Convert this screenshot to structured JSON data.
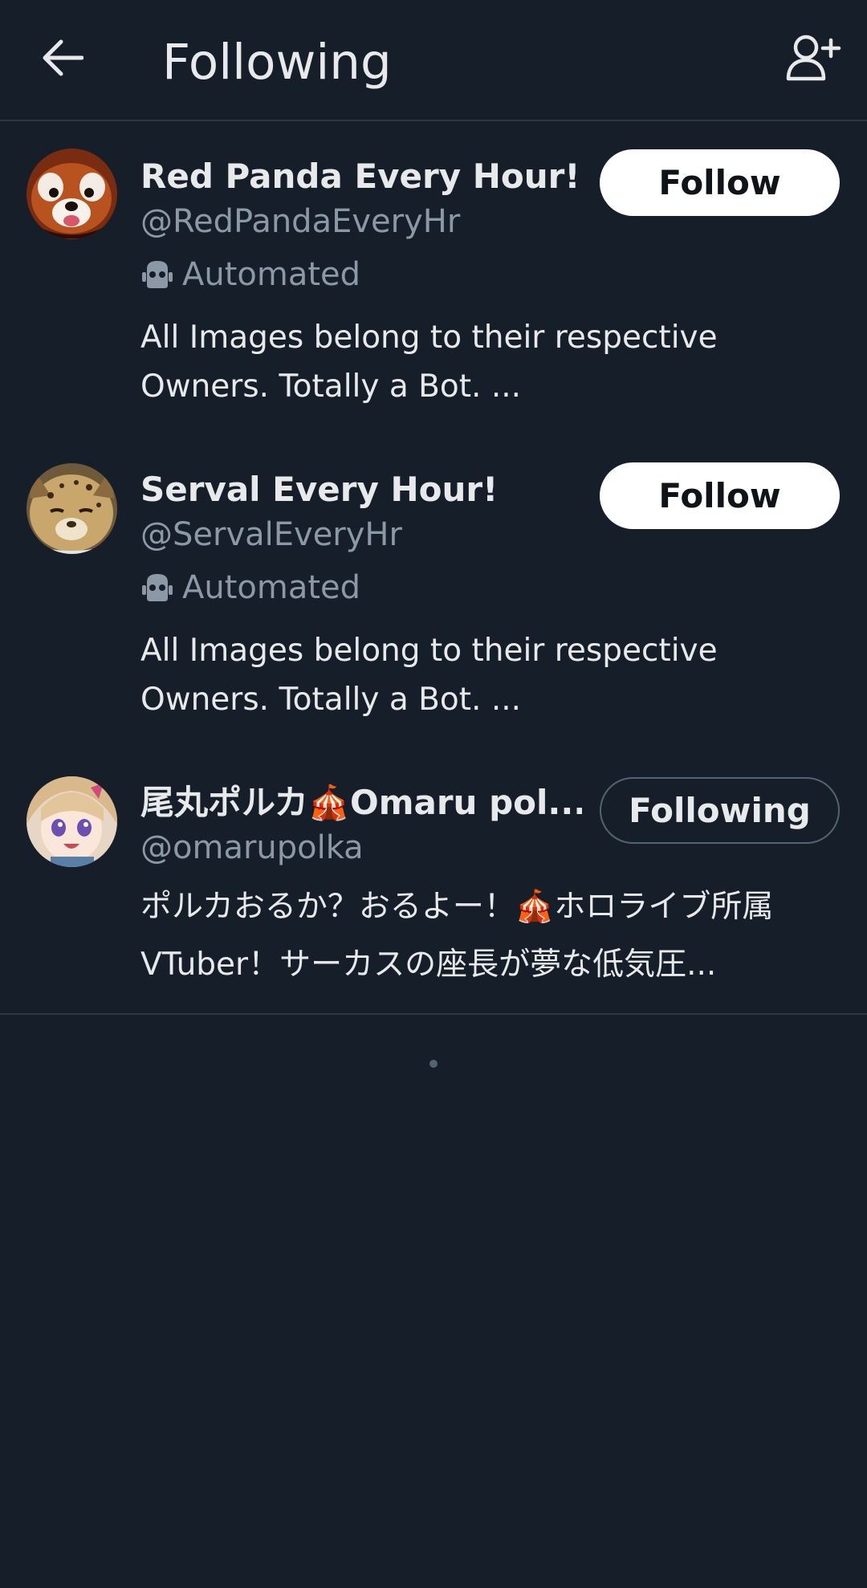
{
  "header": {
    "title": "Following",
    "back_icon": "arrow-left-icon",
    "add_user_icon": "person-add-icon"
  },
  "users": [
    {
      "name": "Red Panda Every Hour!",
      "handle": "@RedPandaEveryHr",
      "automated": "Automated",
      "bio": "All Images belong to their respective Owners. Totally a Bot. ...",
      "button": "Follow"
    },
    {
      "name": "Serval Every Hour!",
      "handle": "@ServalEveryHr",
      "automated": "Automated",
      "bio": "All Images belong to their respective Owners. Totally a Bot. ...",
      "button": "Follow"
    },
    {
      "name": "尾丸ポルカ🎪Omaru pol...",
      "handle": "@omarupolka",
      "bio": "ポルカおるか？おるよー！🎪ホロライブ所属VTuber！サーカスの座長が夢な低気圧...",
      "button": "Following"
    }
  ],
  "colors": {
    "background": "#161e29",
    "primary_text": "#e7e9ea",
    "secondary_text": "#8b98a5",
    "divider": "#2f3741",
    "button_bg": "#ffffff"
  }
}
